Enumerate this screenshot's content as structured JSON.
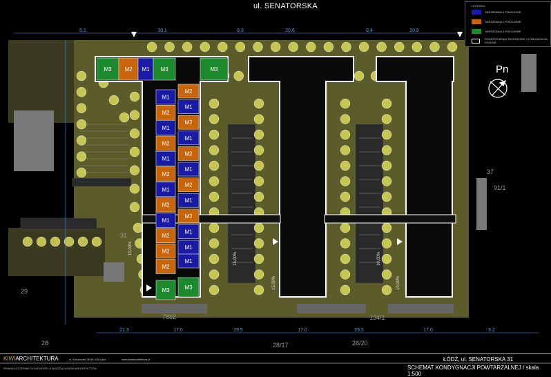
{
  "street_name": "ul. SENATORSKA",
  "north_label": "Pn",
  "legend": {
    "title": "LEGENDA",
    "items": [
      {
        "code": "M1",
        "label": "MIESZKANIA 1 POKOJOWE",
        "color": "#1a1aa8"
      },
      {
        "code": "M2",
        "label": "MIESZKANIA 2 POKOJOWE",
        "color": "#c8640a"
      },
      {
        "code": "M3",
        "label": "MIESZKANIA 3 POKOJOWE",
        "color": "#1e8a2e"
      },
      {
        "code": "",
        "label": "POMIESZCZENIA TECHNICZNE / KOMUNIKACJA OGÓLNA",
        "color": "#000000"
      }
    ]
  },
  "units_top_row": [
    "M3",
    "M2",
    "M1",
    "M3",
    "M3"
  ],
  "units_left_column": [
    "M1",
    "M2",
    "M1",
    "M2",
    "M1",
    "M2",
    "M1",
    "M2",
    "M1",
    "M2",
    "M2",
    "M2",
    "M3"
  ],
  "units_right_column": [
    "M2",
    "M1",
    "M2",
    "M1",
    "M2",
    "M1",
    "M2",
    "M1",
    "M2",
    "M1",
    "M1",
    "M1",
    "M3"
  ],
  "dimensions_top": [
    "6,1",
    "30,1",
    "8,3",
    "20,6",
    "8,4",
    "20,8"
  ],
  "dimensions_bottom": [
    "21,3",
    "17,0",
    "29,5",
    "17,0",
    "29,5",
    "17,0",
    "9,2"
  ],
  "slope_labels": [
    "10,00%",
    "15,00%",
    "15,00%",
    "10,00%",
    "10,00%"
  ],
  "parcel_labels": [
    "29",
    "28",
    "78b2",
    "28/17",
    "28/20",
    "134/1",
    "91/1",
    "37",
    "31"
  ],
  "footer": {
    "brand_prefix": "KIWI",
    "brand_suffix": "ARCHITEKTURA",
    "address": "ul. Kościuszki 28 90-418 Łódź",
    "website": "www.kiwiarchitektura.pl",
    "copyright": "PRAWA AUTORSKIE DO KONCEPCJI NALEŻĄ DO KIWI ARCHITEKTURA",
    "city_line": "ŁÓDŹ, ul. SENATORSKA 31",
    "sheet_title": "SCHEMAT KONDYGNACJI POWTARZALNEJ / skala 1:500"
  },
  "colors": {
    "background": "#000000",
    "greenery": "#5c5c2a",
    "tree": "#d8d85a",
    "building_outline": "#ffffff",
    "road": "#4a4a4a",
    "m1": "#1a1aa8",
    "m2": "#c8640a",
    "m3": "#1e8a2e"
  }
}
